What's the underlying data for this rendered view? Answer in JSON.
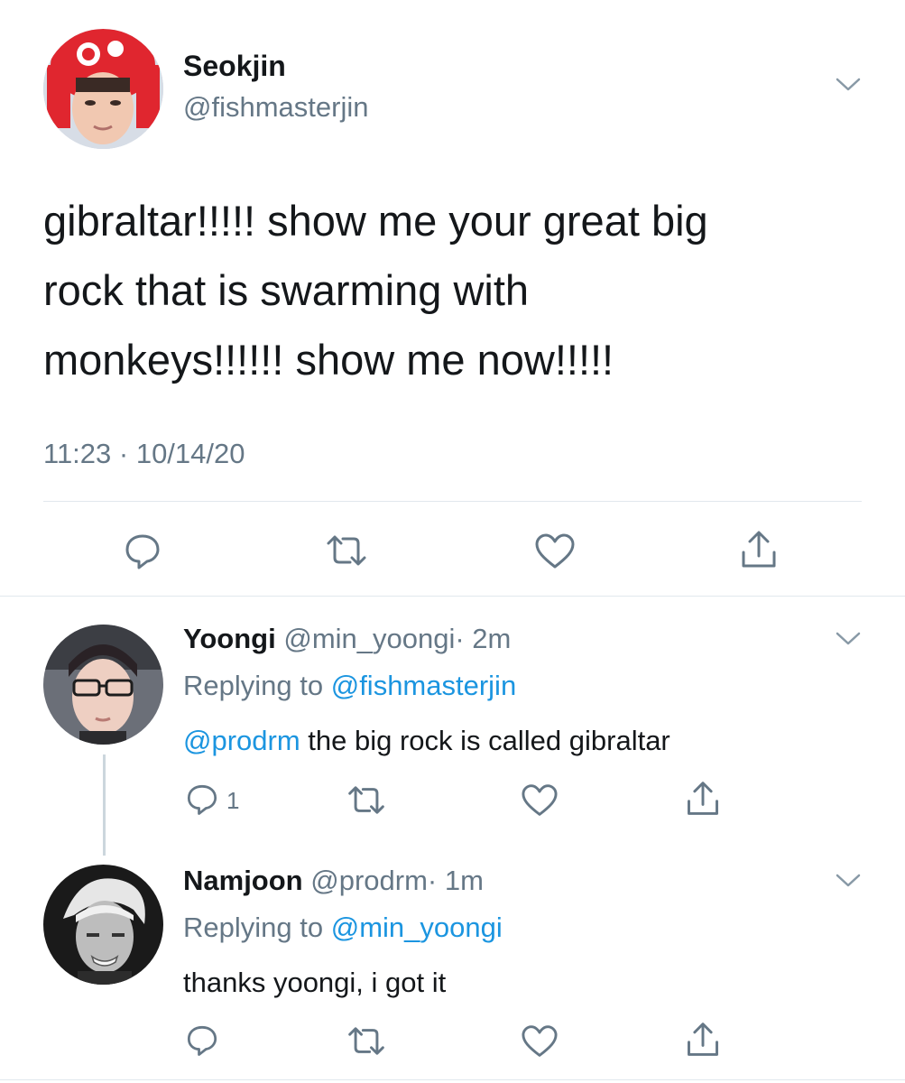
{
  "main_tweet": {
    "display_name": "Seokjin",
    "handle": "@fishmasterjin",
    "text_lines": [
      "gibraltar!!!!! show me your great big",
      "rock that is swarming with",
      "monkeys!!!!!! show me now!!!!!"
    ],
    "timestamp": "11:23 · 10/14/20"
  },
  "replies": [
    {
      "display_name": "Yoongi",
      "handle": "@min_yoongi",
      "time": "· 2m",
      "replying_prefix": "Replying to",
      "replying_to": "@fishmasterjin",
      "mention": "@prodrm",
      "text": " the big rock is called gibraltar",
      "reply_count": "1"
    },
    {
      "display_name": "Namjoon",
      "handle": "@prodrm",
      "time": "· 1m",
      "replying_prefix": "Replying to",
      "replying_to": "@min_yoongi",
      "text": "thanks yoongi, i got it",
      "reply_count": ""
    }
  ],
  "icons": [
    "chevron-down-icon",
    "reply-icon",
    "retweet-icon",
    "like-icon",
    "share-icon"
  ],
  "colors": {
    "link": "#1b95e0",
    "secondary": "#657786",
    "divider": "#e1e8ed"
  }
}
